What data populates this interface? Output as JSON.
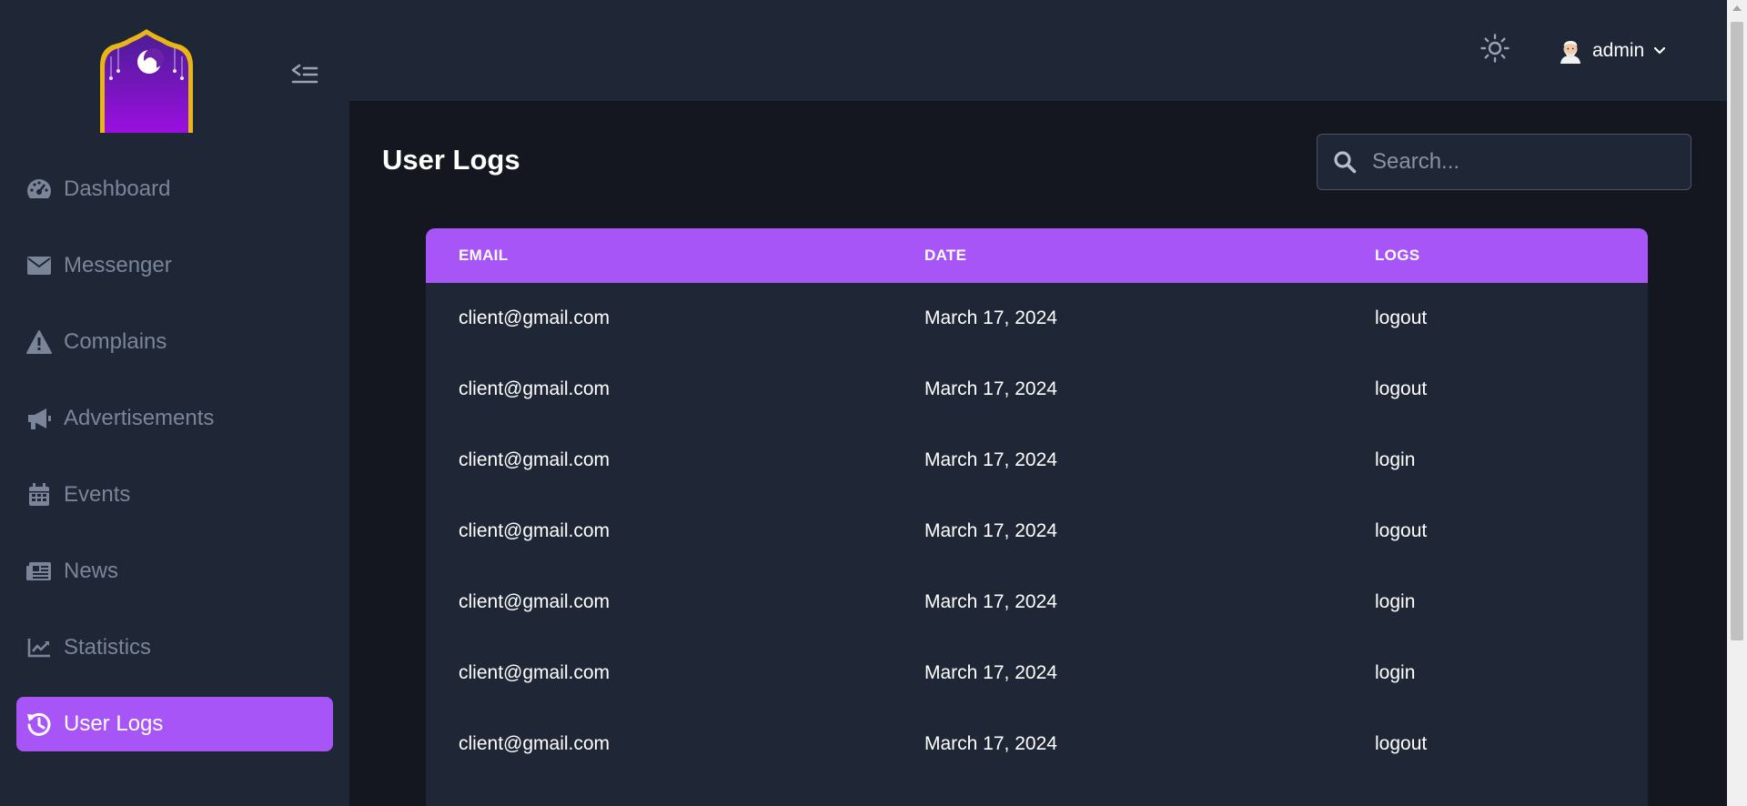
{
  "sidebar": {
    "items": [
      {
        "label": "Dashboard",
        "icon": "dashboard-gauge-icon"
      },
      {
        "label": "Messenger",
        "icon": "envelope-icon"
      },
      {
        "label": "Complains",
        "icon": "warning-triangle-icon"
      },
      {
        "label": "Advertisements",
        "icon": "megaphone-icon"
      },
      {
        "label": "Events",
        "icon": "calendar-icon"
      },
      {
        "label": "News",
        "icon": "newspaper-icon"
      },
      {
        "label": "Statistics",
        "icon": "line-chart-icon"
      },
      {
        "label": "User Logs",
        "icon": "history-icon",
        "active": true
      }
    ]
  },
  "header": {
    "user_name": "admin"
  },
  "main": {
    "title": "User Logs",
    "search_placeholder": "Search..."
  },
  "table": {
    "columns": [
      "EMAIL",
      "DATE",
      "LOGS"
    ],
    "rows": [
      {
        "email": "client@gmail.com",
        "date": "March 17, 2024",
        "log": "logout"
      },
      {
        "email": "client@gmail.com",
        "date": "March 17, 2024",
        "log": "logout"
      },
      {
        "email": "client@gmail.com",
        "date": "March 17, 2024",
        "log": "login"
      },
      {
        "email": "client@gmail.com",
        "date": "March 17, 2024",
        "log": "logout"
      },
      {
        "email": "client@gmail.com",
        "date": "March 17, 2024",
        "log": "login"
      },
      {
        "email": "client@gmail.com",
        "date": "March 17, 2024",
        "log": "login"
      },
      {
        "email": "client@gmail.com",
        "date": "March 17, 2024",
        "log": "logout"
      }
    ]
  },
  "colors": {
    "accent": "#a855f7",
    "sidebar_bg": "#1f2636",
    "page_bg": "#141720"
  }
}
